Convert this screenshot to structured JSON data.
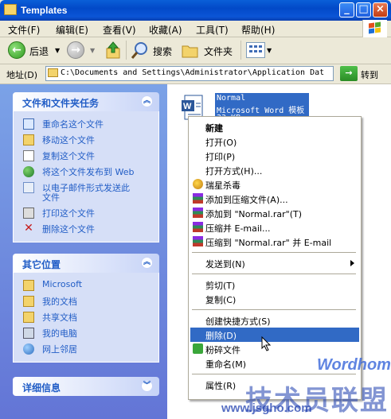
{
  "window": {
    "title": "Templates"
  },
  "menubar": {
    "items": [
      "文件(F)",
      "编辑(E)",
      "查看(V)",
      "收藏(A)",
      "工具(T)",
      "帮助(H)"
    ]
  },
  "toolbar": {
    "back_label": "后退",
    "search_label": "搜索",
    "folders_label": "文件夹"
  },
  "address": {
    "label": "地址(D)",
    "value": "C:\\Documents and Settings\\Administrator\\Application Dat",
    "go_label": "转到"
  },
  "tasks_panel": {
    "title": "文件和文件夹任务",
    "items": [
      {
        "label": "重命名这个文件",
        "icon": "rename-icon"
      },
      {
        "label": "移动这个文件",
        "icon": "move-icon"
      },
      {
        "label": "复制这个文件",
        "icon": "copy-icon"
      },
      {
        "label": "将这个文件发布到 Web",
        "icon": "web-publish-icon"
      },
      {
        "label": "以电子邮件形式发送此",
        "label2": "文件",
        "icon": "email-icon"
      },
      {
        "label": "打印这个文件",
        "icon": "print-icon"
      },
      {
        "label": "删除这个文件",
        "icon": "delete-icon"
      }
    ]
  },
  "places_panel": {
    "title": "其它位置",
    "items": [
      {
        "label": "Microsoft",
        "icon": "folder-icon"
      },
      {
        "label": "我的文档",
        "icon": "my-documents-icon"
      },
      {
        "label": "共享文档",
        "icon": "shared-folder-icon"
      },
      {
        "label": "我的电脑",
        "icon": "my-computer-icon"
      },
      {
        "label": "网上邻居",
        "icon": "network-icon"
      }
    ]
  },
  "details_panel": {
    "title": "详细信息"
  },
  "file": {
    "name": "Normal",
    "type": "Microsoft Word 模板",
    "size": "33 KB"
  },
  "context_menu": {
    "items": [
      {
        "label": "新建",
        "bold": true
      },
      {
        "label": "打开(O)"
      },
      {
        "label": "打印(P)"
      },
      {
        "label": "打开方式(H)..."
      },
      {
        "label": "瑞星杀毒",
        "icon": "antivirus-icon"
      },
      {
        "label": "添加到压缩文件(A)...",
        "icon": "winrar-icon"
      },
      {
        "label": "添加到 \"Normal.rar\"(T)",
        "icon": "winrar-icon"
      },
      {
        "label": "压缩并 E-mail...",
        "icon": "winrar-icon"
      },
      {
        "label": "压缩到 \"Normal.rar\" 并 E-mail",
        "icon": "winrar-icon"
      },
      {
        "label": "发送到(N)",
        "submenu": true
      },
      {
        "label": "剪切(T)"
      },
      {
        "label": "复制(C)"
      },
      {
        "label": "创建快捷方式(S)"
      },
      {
        "label": "删除(D)",
        "selected": true
      },
      {
        "label": "粉碎文件",
        "icon": "shred-icon"
      },
      {
        "label": "重命名(M)"
      },
      {
        "label": "属性(R)"
      }
    ]
  },
  "watermark": {
    "brand": "Wordhome",
    "cn": "技术员联盟",
    "url": "www.jsgho.com"
  },
  "colors": {
    "title_bar": "#0a5fd8",
    "selection": "#316ac5",
    "panel_link": "#215dc6"
  }
}
